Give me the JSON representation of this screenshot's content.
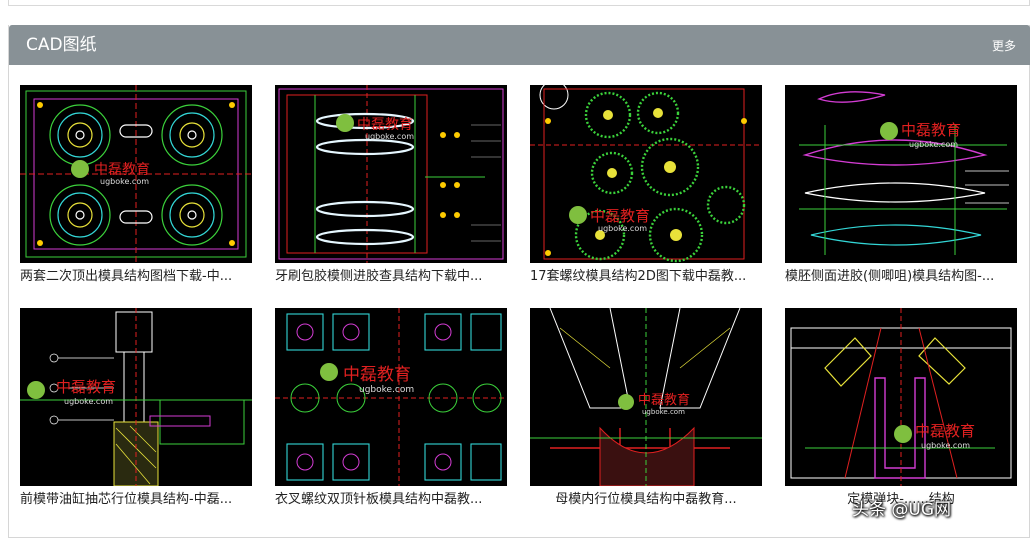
{
  "panel": {
    "title": "CAD图纸",
    "more_label": "更多"
  },
  "cards": [
    {
      "title": "两套二次顶出模具结构图档下载-中..."
    },
    {
      "title": "牙刷包胶模侧进胶查具结构下载中..."
    },
    {
      "title": "17套螺纹模具结构2D图下载中磊教..."
    },
    {
      "title": "模胚侧面进胶(侧唧咀)模具结构图-..."
    },
    {
      "title": "前模带油缸抽芯行位模具结构-中磊..."
    },
    {
      "title": "衣叉螺纹双顶针板模具结构中磊教..."
    },
    {
      "title": "母模内行位模具结构中磊教育..."
    },
    {
      "title": "定模弹块-......结构"
    }
  ],
  "thumb_watermark": {
    "cn": "中磊教育",
    "en": "ugboke.com"
  },
  "page_watermark": {
    "text": "头条 @UG网"
  },
  "colors": {
    "header_bg": "#889196",
    "thumb_bg": "#000000",
    "cad_green": "#3bd13b",
    "cad_magenta": "#d33cd3",
    "cad_red": "#e02020",
    "cad_cyan": "#33d6d6",
    "cad_yellow": "#e8e23a"
  }
}
